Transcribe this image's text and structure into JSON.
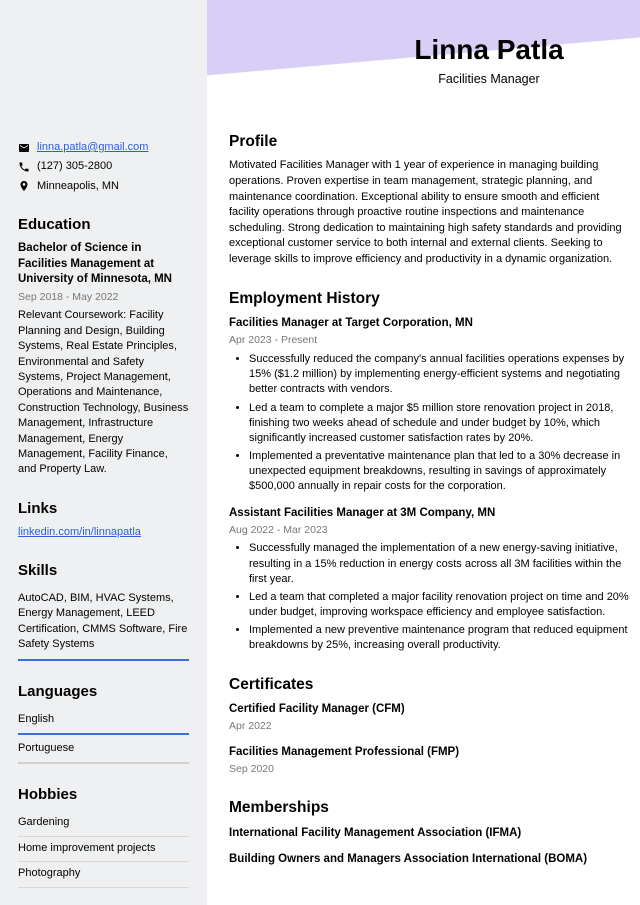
{
  "header": {
    "name": "Linna Patla",
    "title": "Facilities Manager"
  },
  "contact": {
    "email": "linna.patla@gmail.com",
    "phone": "(127) 305-2800",
    "location": "Minneapolis, MN"
  },
  "education": {
    "heading": "Education",
    "degree": "Bachelor of Science in Facilities Management at University of Minnesota, MN",
    "dates": "Sep 2018 - May 2022",
    "coursework": "Relevant Coursework: Facility Planning and Design, Building Systems, Real Estate Principles, Environmental and Safety Systems, Project Management, Operations and Maintenance, Construction Technology, Business Management, Infrastructure Management, Energy Management, Facility Finance, and Property Law."
  },
  "links": {
    "heading": "Links",
    "url": "linkedin.com/in/linnapatla"
  },
  "skills": {
    "heading": "Skills",
    "text": "AutoCAD, BIM, HVAC Systems, Energy Management, LEED Certification, CMMS Software, Fire Safety Systems"
  },
  "languages": {
    "heading": "Languages",
    "items": [
      "English",
      "Portuguese"
    ]
  },
  "hobbies": {
    "heading": "Hobbies",
    "items": [
      "Gardening",
      "Home improvement projects",
      "Photography"
    ]
  },
  "profile": {
    "heading": "Profile",
    "text": "Motivated Facilities Manager with 1 year of experience in managing building operations. Proven expertise in team management, strategic planning, and maintenance coordination. Exceptional ability to ensure smooth and efficient facility operations through proactive routine inspections and maintenance scheduling. Strong dedication to maintaining high safety standards and providing exceptional customer service to both internal and external clients. Seeking to leverage skills to improve efficiency and productivity in a dynamic organization."
  },
  "employment": {
    "heading": "Employment History",
    "jobs": [
      {
        "title": "Facilities Manager at Target Corporation, MN",
        "dates": "Apr 2023 - Present",
        "bullets": [
          "Successfully reduced the company's annual facilities operations expenses by 15% ($1.2 million) by implementing energy-efficient systems and negotiating better contracts with vendors.",
          "Led a team to complete a major $5 million store renovation project in 2018, finishing two weeks ahead of schedule and under budget by 10%, which significantly increased customer satisfaction rates by 20%.",
          "Implemented a preventative maintenance plan that led to a 30% decrease in unexpected equipment breakdowns, resulting in savings of approximately $500,000 annually in repair costs for the corporation."
        ]
      },
      {
        "title": "Assistant Facilities Manager at 3M Company, MN",
        "dates": "Aug 2022 - Mar 2023",
        "bullets": [
          "Successfully managed the implementation of a new energy-saving initiative, resulting in a 15% reduction in energy costs across all 3M facilities within the first year.",
          "Led a team that completed a major facility renovation project on time and 20% under budget, improving workspace efficiency and employee satisfaction.",
          "Implemented a new preventive maintenance program that reduced equipment breakdowns by 25%, increasing overall productivity."
        ]
      }
    ]
  },
  "certificates": {
    "heading": "Certificates",
    "items": [
      {
        "title": "Certified Facility Manager (CFM)",
        "date": "Apr 2022"
      },
      {
        "title": "Facilities Management Professional (FMP)",
        "date": "Sep 2020"
      }
    ]
  },
  "memberships": {
    "heading": "Memberships",
    "items": [
      "International Facility Management Association (IFMA)",
      "Building Owners and Managers Association International (BOMA)"
    ]
  }
}
